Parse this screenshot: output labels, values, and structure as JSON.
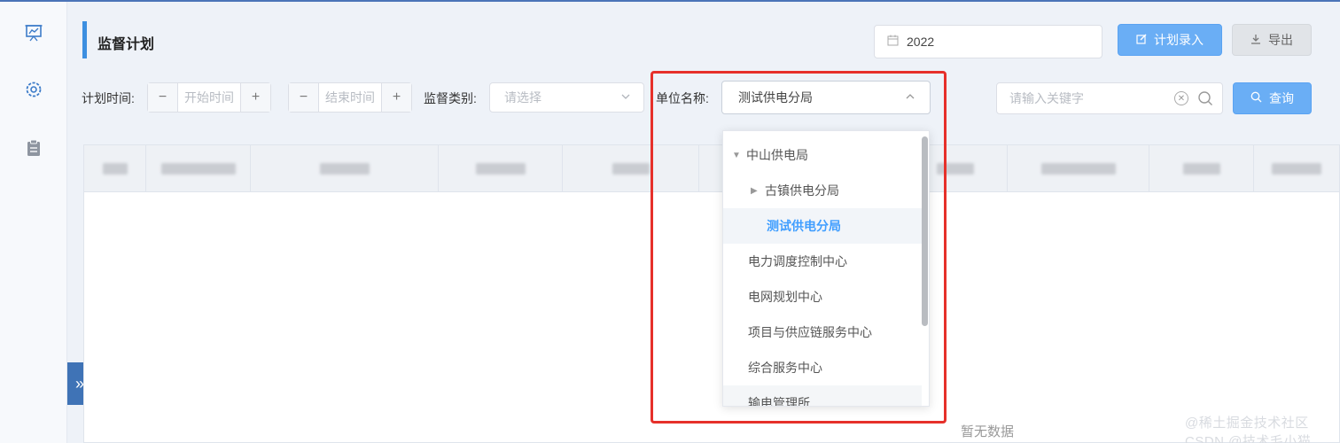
{
  "sidebar": {
    "icons": [
      "presentation-chart-icon",
      "gear-icon",
      "clipboard-icon"
    ],
    "expand_glyph": "»"
  },
  "header": {
    "title": "监督计划",
    "year": "2022",
    "plan_entry_label": "计划录入",
    "export_label": "导出"
  },
  "filters": {
    "plan_time_label": "计划时间:",
    "start_placeholder": "开始时间",
    "end_placeholder": "结束时间",
    "minus": "−",
    "plus": "+",
    "category_label": "监督类别:",
    "category_placeholder": "请选择",
    "unit_label": "单位名称:",
    "unit_value": "测试供电分局",
    "search_placeholder": "请输入关键字",
    "query_label": "查询"
  },
  "dropdown": {
    "items": [
      {
        "label": "中山供电局",
        "caret": "▼",
        "level": 0
      },
      {
        "label": "古镇供电分局",
        "caret": "▶",
        "level": 1
      },
      {
        "label": "测试供电分局",
        "caret": "",
        "level": 2,
        "selected": true
      },
      {
        "label": "电力调度控制中心",
        "caret": "",
        "level": 0
      },
      {
        "label": "电网规划中心",
        "caret": "",
        "level": 0
      },
      {
        "label": "项目与供应链服务中心",
        "caret": "",
        "level": 0
      },
      {
        "label": "综合服务中心",
        "caret": "",
        "level": 0
      },
      {
        "label": "输电管理所",
        "caret": "",
        "level": 0
      }
    ]
  },
  "table": {
    "empty_text": "暂无数据"
  },
  "watermark": "@稀土掘金技术社区 CSDN @技术毛小猫",
  "colors": {
    "accent": "#409eff",
    "primary_button": "#6aaef5",
    "highlight_border": "#e6302a",
    "sidebar_toggle": "#3f73b6"
  }
}
